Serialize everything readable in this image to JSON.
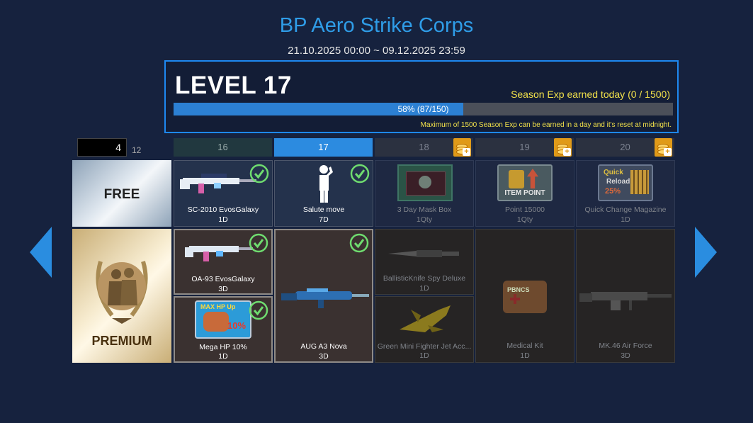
{
  "header": {
    "title": "BP Aero Strike Corps",
    "dates": "21.10.2025 00:00 ~ 09.12.2025 23:59"
  },
  "level_panel": {
    "level_label": "LEVEL 17",
    "exp_today": "Season Exp earned today (0 / 1500)",
    "progress_text": "58% (87/150)",
    "progress_fraction": 0.58,
    "note": "Maximum of 1500 Season Exp can be earned in a day and it's reset at midnight."
  },
  "pager": {
    "current": "4",
    "total": "12"
  },
  "tabs": [
    {
      "label": "16",
      "state": "done"
    },
    {
      "label": "17",
      "state": "current"
    },
    {
      "label": "18",
      "state": "locked"
    },
    {
      "label": "19",
      "state": "locked"
    },
    {
      "label": "20",
      "state": "locked"
    }
  ],
  "rows": {
    "free_label": "FREE",
    "premium_label": "PREMIUM"
  },
  "free_rewards": [
    {
      "name": "SC-2010 EvosGalaxy",
      "duration": "1D",
      "icon": "rifle-icon"
    },
    {
      "name": "Salute move",
      "duration": "7D",
      "icon": "salute-icon"
    },
    {
      "name": "3 Day Mask Box",
      "duration": "1Qty",
      "icon": "mask-box-icon"
    },
    {
      "name": "Point 15000",
      "duration": "1Qty",
      "icon": "item-point-icon"
    },
    {
      "name": "Quick Change Magazine",
      "duration": "1D",
      "icon": "quick-reload-icon"
    }
  ],
  "premium_rewards": [
    {
      "name": "OA-93 EvosGalaxy",
      "duration": "3D",
      "icon": "rifle-icon"
    },
    {
      "name": "Mega HP 10%",
      "duration": "1D",
      "icon": "max-hp-icon"
    },
    {
      "name": "AUG A3 Nova",
      "duration": "3D",
      "icon": "rifle-icon"
    },
    {
      "name": "BallisticKnife Spy Deluxe",
      "duration": "1D",
      "icon": "knife-icon"
    },
    {
      "name": "Green Mini Fighter Jet Acc...",
      "duration": "1D",
      "icon": "jet-icon"
    },
    {
      "name": "Medical Kit",
      "duration": "1D",
      "icon": "medical-kit-icon"
    },
    {
      "name": "MK.46 Air Force",
      "duration": "3D",
      "icon": "machine-gun-icon"
    }
  ],
  "item_art": {
    "point_text": "ITEM POINT",
    "reload_top": "Quick",
    "reload_mid": "Reload",
    "reload_pct": "25%",
    "hp_top": "MAX HP Up",
    "hp_pct": "10%",
    "medkit_text": "PBNCS"
  },
  "colors": {
    "accent": "#2c8be0",
    "title": "#2f9de8",
    "gold": "#f2e14a",
    "check": "#6fdc6f"
  }
}
